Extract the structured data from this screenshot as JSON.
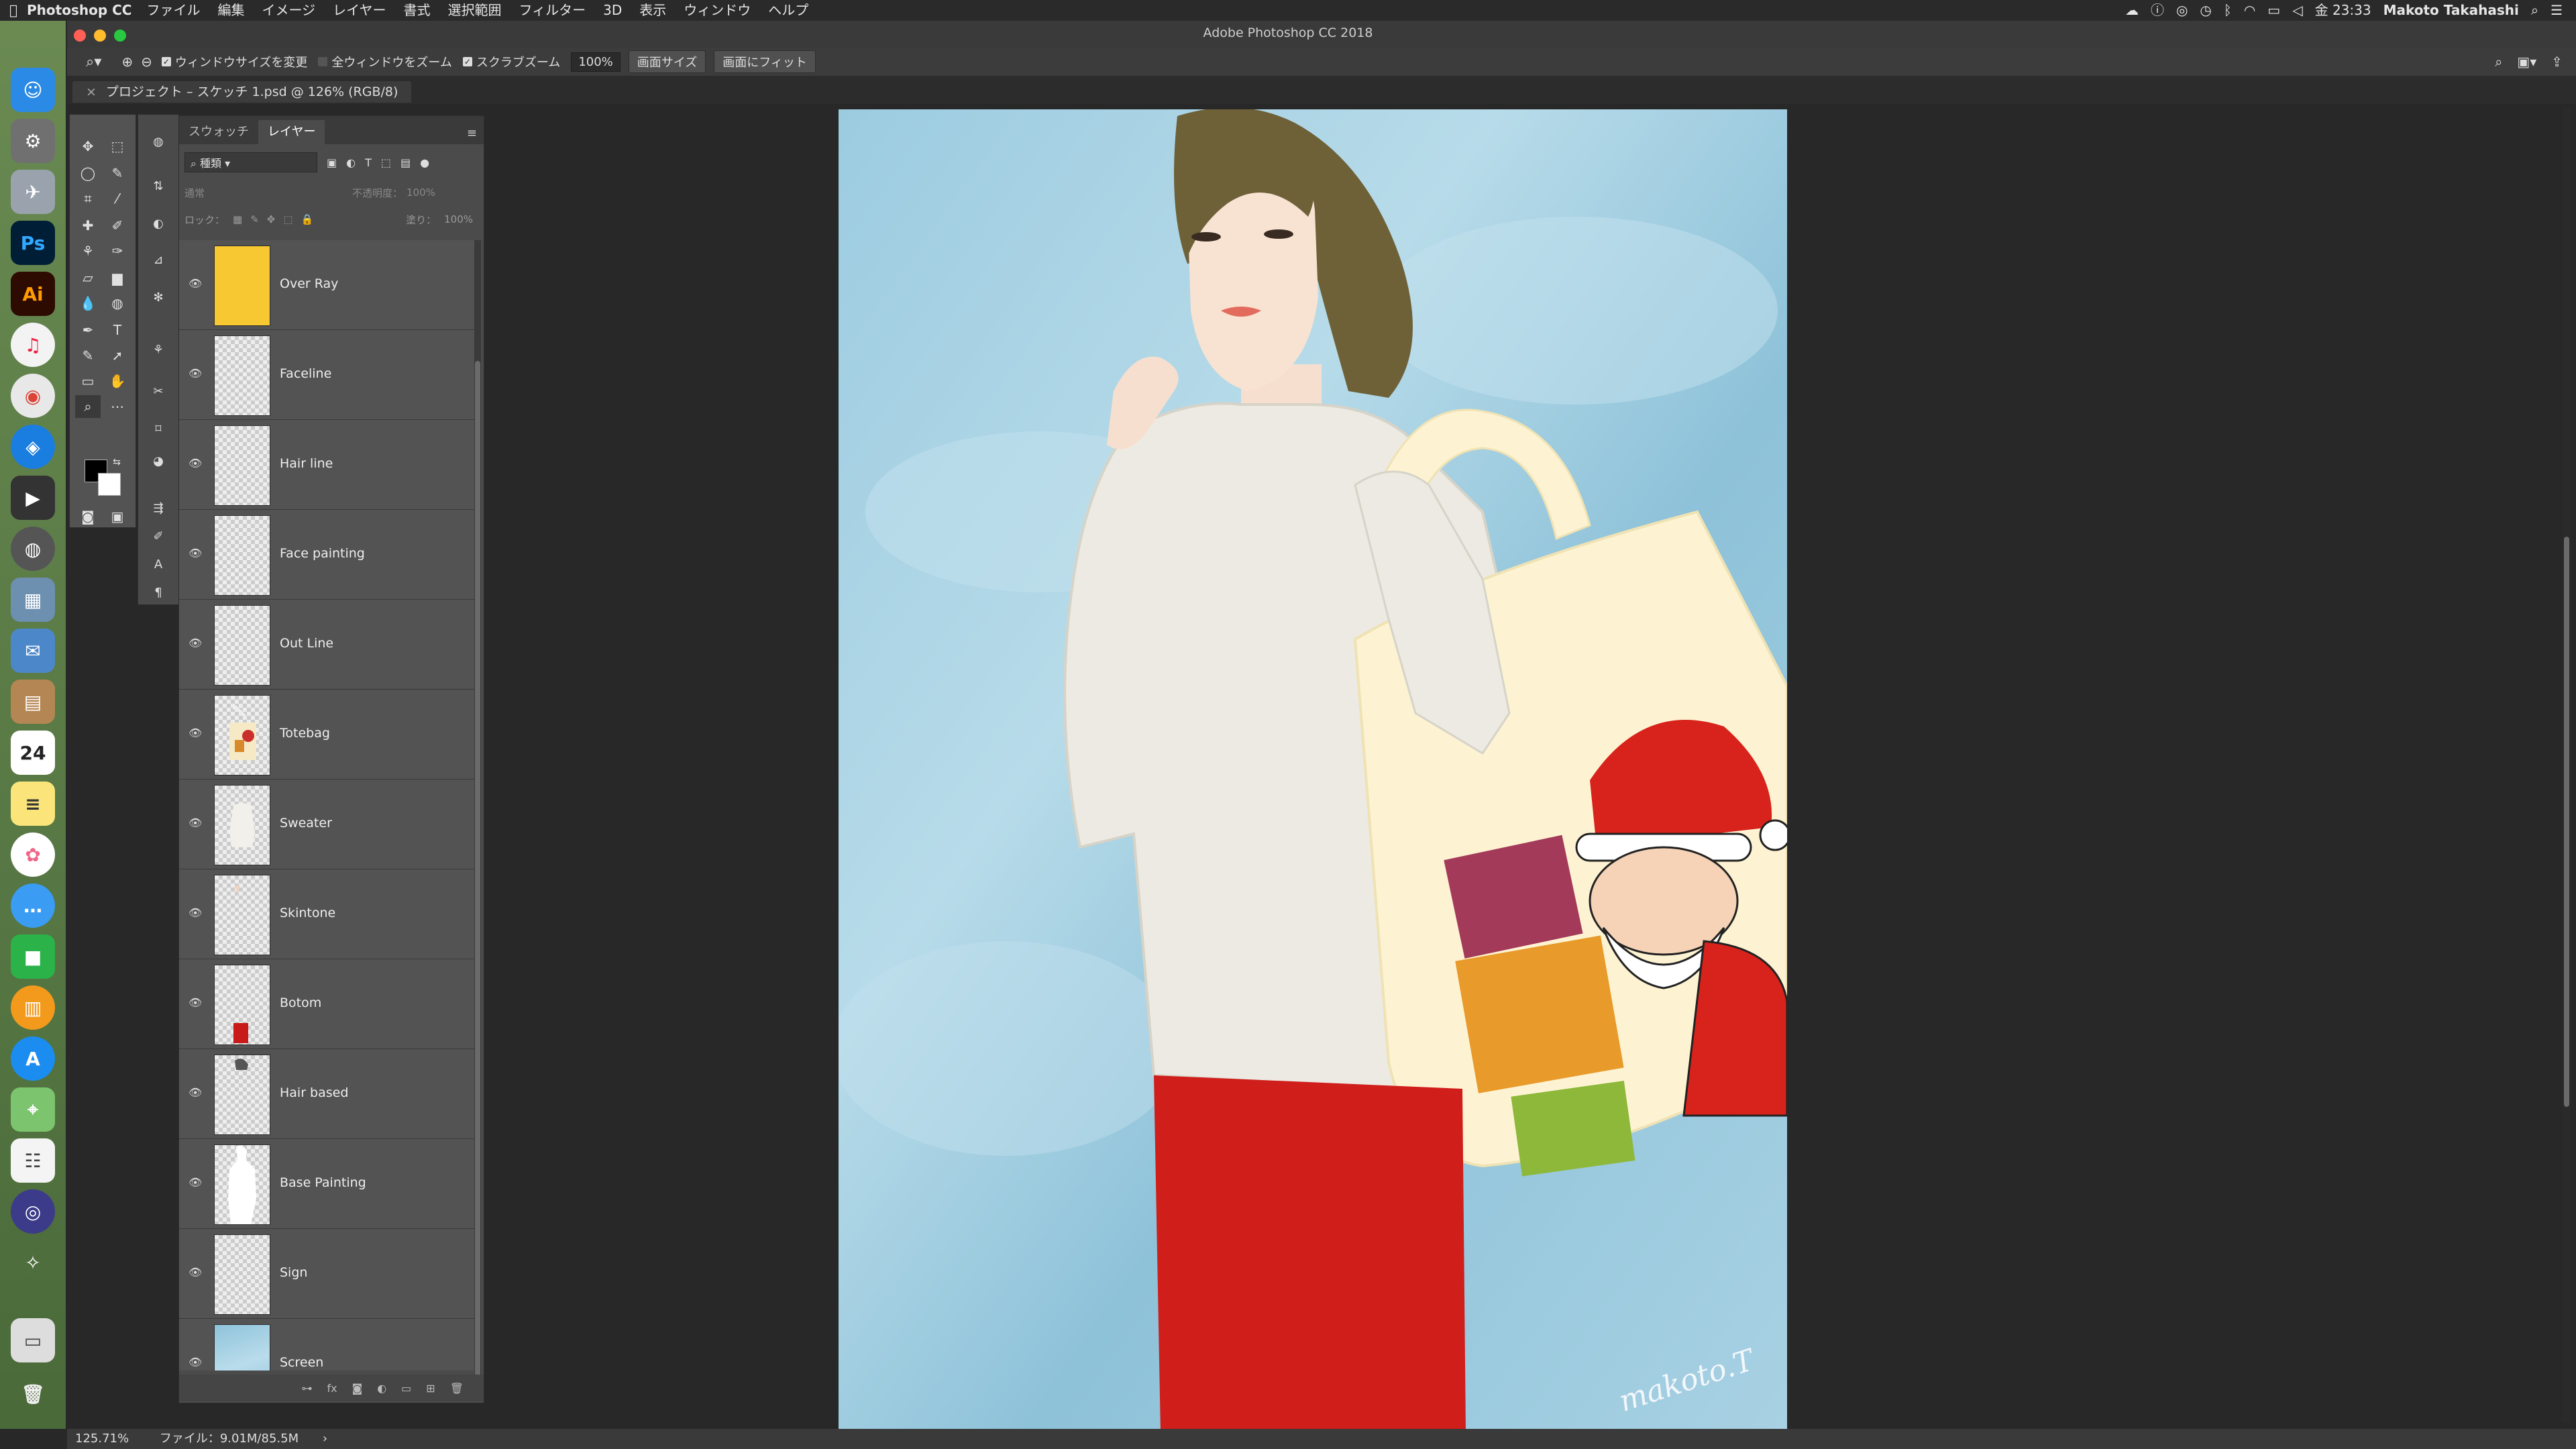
{
  "menubar": {
    "app_name": "Photoshop CC",
    "items": [
      "ファイル",
      "編集",
      "イメージ",
      "レイヤー",
      "書式",
      "選択範囲",
      "フィルター",
      "3D",
      "表示",
      "ウィンドウ",
      "ヘルプ"
    ],
    "clock": "金 23:33",
    "user": "Makoto Takahashi"
  },
  "window": {
    "title": "Adobe Photoshop CC 2018"
  },
  "options_bar": {
    "resize_windows_label": "ウィンドウサイズを変更",
    "zoom_all_label": "全ウィンドウをズーム",
    "scrubby_zoom_label": "スクラブズーム",
    "zoom_value": "100%",
    "fit_screen_button": "画面サイズ",
    "fill_screen_button": "画面にフィット"
  },
  "document_tab": {
    "label": "プロジェクト – スケッチ 1.psd @ 126% (RGB/8)"
  },
  "layers_panel": {
    "tab_swatches": "スウォッチ",
    "tab_layers": "レイヤー",
    "filter_kind": "種類",
    "blend_mode": "通常",
    "opacity_label": "不透明度：",
    "opacity_value": "100%",
    "lock_label": "ロック：",
    "fill_label": "塗り：",
    "fill_value": "100%",
    "layers": [
      {
        "name": "Over Ray",
        "thumb": "yellow"
      },
      {
        "name": "Faceline",
        "thumb": "transparent"
      },
      {
        "name": "Hair line",
        "thumb": "transparent"
      },
      {
        "name": "Face painting",
        "thumb": "transparent"
      },
      {
        "name": "Out Line",
        "thumb": "transparent"
      },
      {
        "name": "Totebag",
        "thumb": "bag"
      },
      {
        "name": "Sweater",
        "thumb": "sweater"
      },
      {
        "name": "Skintone",
        "thumb": "transparent"
      },
      {
        "name": "Botom",
        "thumb": "bottom"
      },
      {
        "name": "Hair based",
        "thumb": "transparent"
      },
      {
        "name": "Base Painting",
        "thumb": "silhouette"
      },
      {
        "name": "Sign",
        "thumb": "transparent"
      },
      {
        "name": "Screen",
        "thumb": "sky"
      }
    ]
  },
  "status_bar": {
    "zoom": "125.71%",
    "file_info": "ファイル：9.01M/85.5M"
  },
  "artwork": {
    "signature": "makoto.T"
  },
  "colors": {
    "accent_yellow": "#F8C832",
    "pants_red": "#D01E1A",
    "sky_blue": "#8FC3DA"
  }
}
